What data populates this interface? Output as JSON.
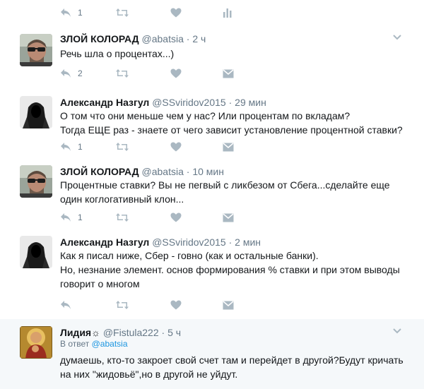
{
  "colors": {
    "thread_line": "#d9b9ec",
    "icon": "#aab8c2",
    "link": "#1b95e0"
  },
  "top_fragment": {
    "reply_count": "1"
  },
  "tweets": [
    {
      "name": "ЗЛОЙ КОЛОРАД",
      "handle": "@abatsia",
      "time": "2 ч",
      "lines": [
        "Речь шла о процентах...)"
      ],
      "reply_count": "2",
      "avatar": "man-with-sunglasses"
    },
    {
      "name": "Александр Назгул",
      "handle": "@SSviridov2015",
      "time": "29 мин",
      "lines": [
        "О том что они меньше чем у нас? Или процентам по вкладам?",
        "Тогда ЕЩЕ раз - знаете от чего зависит установление процентной ставки?"
      ],
      "reply_count": "1",
      "avatar": "hooded-figure"
    },
    {
      "name": "ЗЛОЙ КОЛОРАД",
      "handle": "@abatsia",
      "time": "10 мин",
      "lines": [
        "Процентные ставки? Вы не пегвый с ликбезом от Сбега...сделайте еще",
        "один коглогативный клон..."
      ],
      "reply_count": "1",
      "avatar": "man-with-sunglasses"
    },
    {
      "name": "Александр Назгул",
      "handle": "@SSviridov2015",
      "time": "2 мин",
      "lines": [
        "Как я писал ниже, Сбер - говно (как и остальные банки).",
        "Но, незнание элемент. основ формирования % ставки и при этом выводы",
        "говорит о многом"
      ],
      "reply_count": "",
      "avatar": "hooded-figure"
    },
    {
      "name": "Лидия☼",
      "handle": "@Fistula222",
      "time": "5 ч",
      "reply_to_prefix": "В ответ",
      "reply_to_user": "@abatsia",
      "lines": [
        "думаешь, кто-то закроет свой счет там и перейдет в другой?Будут кричать",
        "на них \"жидовьё\",но в другой не уйдут."
      ],
      "avatar": "icon-painting"
    }
  ]
}
